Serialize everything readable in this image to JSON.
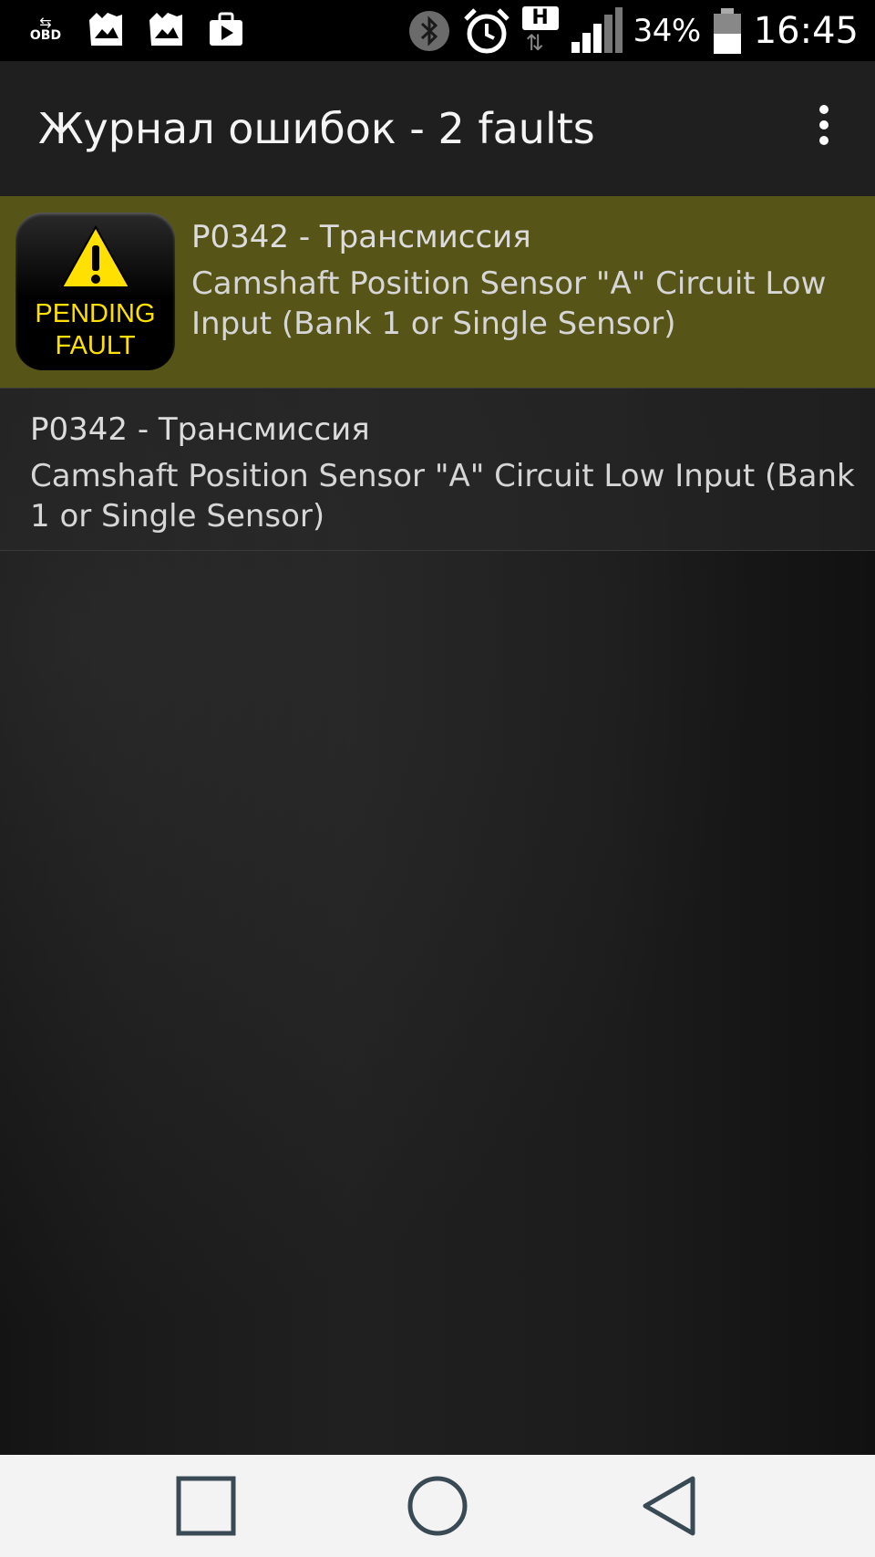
{
  "status_bar": {
    "obd_label": "OBD",
    "battery": "34%",
    "time": "16:45",
    "signal_type": "H",
    "icons": [
      "obd-icon",
      "photo-icon",
      "photo-icon",
      "bag-icon",
      "bluetooth-icon",
      "alarm-icon",
      "hspa-icon",
      "signal-icon",
      "battery-icon"
    ]
  },
  "action_bar": {
    "title": "Журнал ошибок - 2 faults",
    "menu_icon": "overflow-menu-icon"
  },
  "faults": [
    {
      "badge_line1": "PENDING",
      "badge_line2": "FAULT",
      "code": "P0342 - Трансмиссия",
      "description": "Camshaft Position Sensor \"A\" Circuit Low Input (Bank 1 or Single Sensor)"
    },
    {
      "code": "P0342 - Трансмиссия",
      "description": "Camshaft Position Sensor \"A\" Circuit Low Input (Bank 1 or Single Sensor)"
    }
  ],
  "nav_bar": {
    "icons": [
      "recents-icon",
      "home-icon",
      "back-icon"
    ]
  },
  "colors": {
    "selected_row": "#575418",
    "badge_yellow": "#ffe000",
    "action_bar": "#1f1f1f",
    "nav_bar": "#f3f3f3"
  }
}
